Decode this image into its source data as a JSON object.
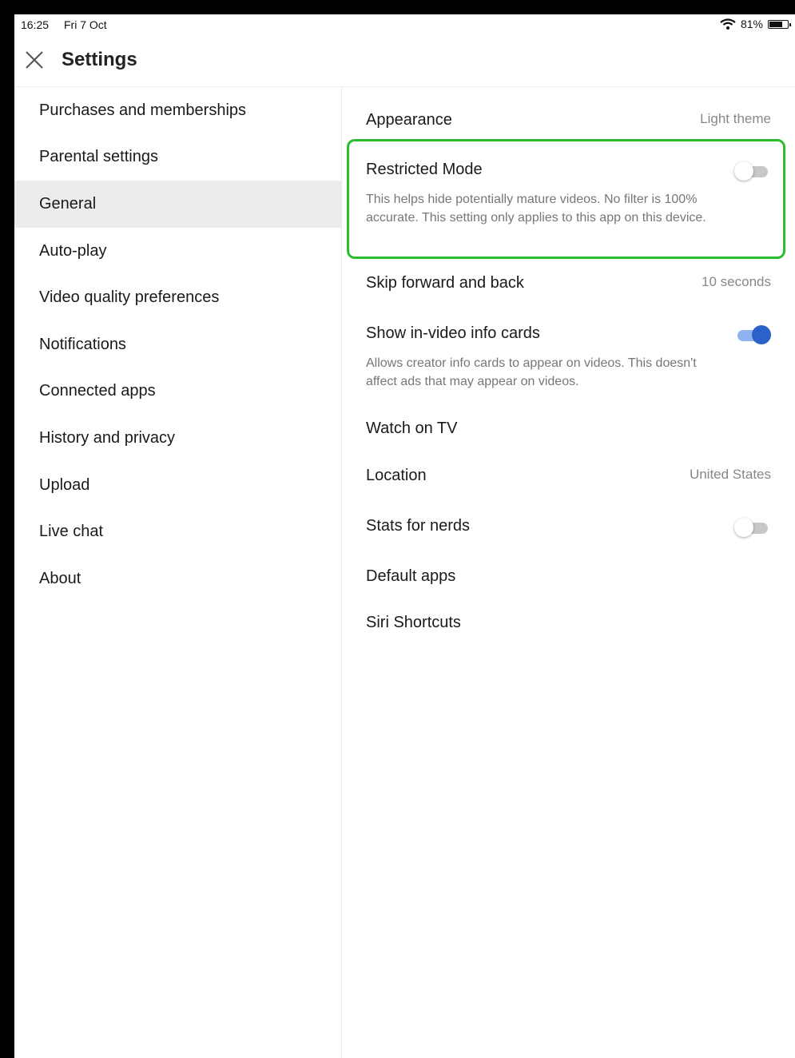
{
  "status_bar": {
    "time": "16:25",
    "date": "Fri 7 Oct",
    "battery_text": "81%",
    "battery_level": 0.81,
    "icons": [
      "wifi-icon",
      "battery-icon"
    ]
  },
  "header": {
    "title": "Settings",
    "close_icon": "close-icon"
  },
  "sidebar": {
    "items": [
      {
        "label": "Purchases and memberships"
      },
      {
        "label": "Parental settings"
      },
      {
        "label": "General",
        "active": true
      },
      {
        "label": "Auto-play"
      },
      {
        "label": "Video quality preferences"
      },
      {
        "label": "Notifications"
      },
      {
        "label": "Connected apps"
      },
      {
        "label": "History and privacy"
      },
      {
        "label": "Upload"
      },
      {
        "label": "Live chat"
      },
      {
        "label": "About"
      }
    ]
  },
  "general": {
    "appearance": {
      "label": "Appearance",
      "value": "Light theme"
    },
    "restricted_mode": {
      "label": "Restricted Mode",
      "enabled": false,
      "description": "This helps hide potentially mature videos. No filter is 100% accurate. This setting only applies to this app on this device."
    },
    "skip": {
      "label": "Skip forward and back",
      "value": "10 seconds"
    },
    "info_cards": {
      "label": "Show in-video info cards",
      "enabled": true,
      "description": "Allows creator info cards to appear on videos. This doesn't affect ads that may appear on videos."
    },
    "watch_tv": {
      "label": "Watch on TV"
    },
    "location": {
      "label": "Location",
      "value": "United States"
    },
    "stats": {
      "label": "Stats for nerds",
      "enabled": false
    },
    "default_apps": {
      "label": "Default apps"
    },
    "siri": {
      "label": "Siri Shortcuts"
    }
  },
  "colors": {
    "highlight": "#2bbd2b",
    "toggle_on": "#2a62c9",
    "active_item_bg": "#ececec"
  }
}
